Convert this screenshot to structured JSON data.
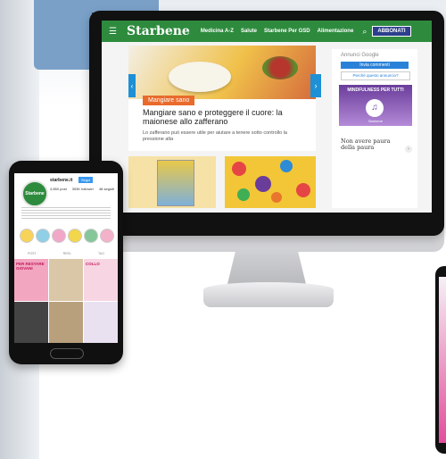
{
  "website": {
    "logo": "Starbene",
    "nav_items": [
      "Medicina A-Z",
      "Salute",
      "Starbene Per GSD",
      "Alimentazione"
    ],
    "subscribe_label": "ABBONATI",
    "hero": {
      "tag": "Mangiare sano",
      "title": "Mangiare sano e proteggere il cuore: la maionese allo zafferano",
      "subtitle": "Lo zafferano può essere utile per aiutare a tenere sotto controllo la pressione alta"
    },
    "sidebar": {
      "ad_label": "Annunci Google",
      "ad_button": "Invia commenti",
      "ad_question": "Perché questo annuncio?",
      "promo_title": "MINDFULNESS PER TUTTI",
      "promo_brand": "Starbene",
      "article_title": "Non avere paura della paura"
    }
  },
  "phone": {
    "avatar_text": "Starbene",
    "username": "starbene.it",
    "follow_label": "Segui",
    "stats": [
      "4.850 post",
      "393K follower",
      "48 seguiti"
    ],
    "grid_texts": [
      "PER RESTARE GIOVANI",
      "COLLO"
    ],
    "tabs": [
      "POST",
      "REEL",
      "TAG"
    ]
  },
  "colors": {
    "brand_green": "#2e8b3e",
    "accent_orange": "#e86b2c",
    "link_blue": "#1e90d6",
    "navy": "#2c3e8c"
  }
}
